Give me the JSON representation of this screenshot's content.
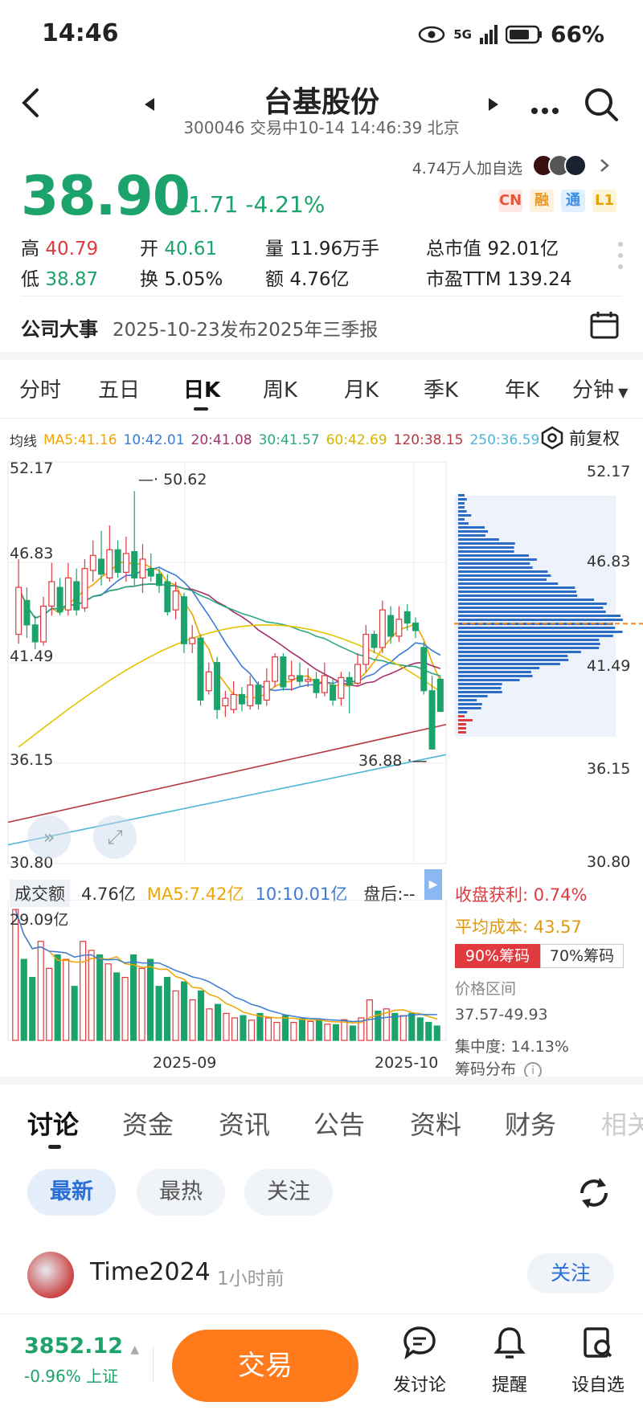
{
  "status": {
    "time": "14:46",
    "battery": "66%",
    "network": "5G"
  },
  "header": {
    "title": "台基股份",
    "subtitle": "300046 交易中10-14 14:46:39 北京"
  },
  "quote": {
    "price": "38.90",
    "change": "-1.71",
    "change_pct": "-4.21%",
    "follow_text": "4.74万人加自选",
    "badges": [
      "CN",
      "融",
      "通",
      "L1"
    ],
    "high_label": "高",
    "high": "40.79",
    "low_label": "低",
    "low": "38.87",
    "open_label": "开",
    "open": "40.61",
    "turnover_label": "换",
    "turnover": "5.05%",
    "volume_label": "量",
    "volume": "11.96万手",
    "amount_label": "额",
    "amount": "4.76亿",
    "mktcap_label": "总市值",
    "mktcap": "92.01亿",
    "pe_label": "市盈TTM",
    "pe": "139.24"
  },
  "event": {
    "label": "公司大事",
    "text": "2025-10-23发布2025年三季报"
  },
  "chart_tabs": [
    "分时",
    "五日",
    "日K",
    "周K",
    "月K",
    "季K",
    "年K",
    "分钟"
  ],
  "active_tab": "日K",
  "ma": {
    "label": "均线",
    "items": [
      "MA5:41.16",
      "10:42.01",
      "20:41.08",
      "30:41.57",
      "60:42.69",
      "120:38.15",
      "250:36.59"
    ],
    "colors": [
      "#f0a500",
      "#3a7bd5",
      "#a2306e",
      "#2aa87e",
      "#e6c200",
      "#b5383e",
      "#4cb6d8"
    ],
    "adjust": "前复权"
  },
  "price_axis": [
    "52.17",
    "46.83",
    "41.49",
    "36.15",
    "30.80"
  ],
  "price_marks": {
    "high": "50.62",
    "low": "36.88"
  },
  "volume": {
    "label": "成交额",
    "value": "4.76亿",
    "ma5": "MA5:7.42亿",
    "ma10": "10:10.01亿",
    "after": "盘后:--",
    "max": "29.09亿",
    "dates": [
      "2025-09",
      "2025-10"
    ]
  },
  "chips": {
    "profit_label": "收盘获利:",
    "profit": "0.74%",
    "cost_label": "平均成本:",
    "cost": "43.57",
    "tab90": "90%筹码",
    "tab70": "70%筹码",
    "range_label": "价格区间",
    "range": "37.57-49.93",
    "concentration": "集中度: 14.13%",
    "dist_label": "筹码分布"
  },
  "bottom_tabs": [
    "讨论",
    "资金",
    "资讯",
    "公告",
    "资料",
    "财务",
    "相关"
  ],
  "filter_pills": [
    "最新",
    "最热",
    "关注"
  ],
  "post": {
    "user": "Time2024",
    "time": "1小时前",
    "follow": "关注"
  },
  "footer": {
    "index_value": "3852.12",
    "index_change": "-0.96%",
    "index_name": "上证",
    "trade": "交易",
    "nav": [
      "发讨论",
      "提醒",
      "设自选"
    ]
  },
  "chart_data": {
    "type": "candlestick",
    "ylim": [
      30.8,
      52.17
    ],
    "candles": [
      {
        "o": 43.0,
        "c": 45.5,
        "h": 47.0,
        "l": 42.5
      },
      {
        "o": 44.8,
        "c": 43.5,
        "h": 45.5,
        "l": 42.8
      },
      {
        "o": 43.5,
        "c": 42.6,
        "h": 44.0,
        "l": 42.2
      },
      {
        "o": 42.6,
        "c": 44.5,
        "h": 45.0,
        "l": 42.4
      },
      {
        "o": 44.5,
        "c": 45.8,
        "h": 46.8,
        "l": 44.0
      },
      {
        "o": 45.5,
        "c": 44.2,
        "h": 46.0,
        "l": 44.0
      },
      {
        "o": 44.3,
        "c": 46.0,
        "h": 46.8,
        "l": 44.0
      },
      {
        "o": 45.8,
        "c": 44.3,
        "h": 46.5,
        "l": 44.0
      },
      {
        "o": 44.4,
        "c": 46.5,
        "h": 47.0,
        "l": 44.2
      },
      {
        "o": 46.4,
        "c": 47.2,
        "h": 48.0,
        "l": 45.8
      },
      {
        "o": 47.0,
        "c": 46.2,
        "h": 48.5,
        "l": 45.6
      },
      {
        "o": 46.0,
        "c": 47.5,
        "h": 48.8,
        "l": 45.8
      },
      {
        "o": 47.5,
        "c": 46.3,
        "h": 48.0,
        "l": 46.0
      },
      {
        "o": 46.3,
        "c": 47.3,
        "h": 48.2,
        "l": 45.8
      },
      {
        "o": 47.4,
        "c": 46.0,
        "h": 50.62,
        "l": 45.6
      },
      {
        "o": 46.0,
        "c": 47.0,
        "h": 47.8,
        "l": 45.2
      },
      {
        "o": 46.5,
        "c": 46.1,
        "h": 47.3,
        "l": 45.8
      },
      {
        "o": 46.2,
        "c": 45.6,
        "h": 46.5,
        "l": 45.2
      },
      {
        "o": 45.8,
        "c": 44.2,
        "h": 46.2,
        "l": 44.0
      },
      {
        "o": 44.3,
        "c": 45.3,
        "h": 45.8,
        "l": 43.8
      },
      {
        "o": 45.0,
        "c": 42.5,
        "h": 45.2,
        "l": 42.0
      },
      {
        "o": 42.5,
        "c": 42.8,
        "h": 43.5,
        "l": 42.0
      },
      {
        "o": 42.8,
        "c": 39.5,
        "h": 43.0,
        "l": 39.2
      },
      {
        "o": 40.0,
        "c": 41.0,
        "h": 41.5,
        "l": 39.8
      },
      {
        "o": 41.5,
        "c": 39.0,
        "h": 41.8,
        "l": 38.5
      },
      {
        "o": 39.2,
        "c": 39.6,
        "h": 40.0,
        "l": 38.6
      },
      {
        "o": 39.0,
        "c": 39.8,
        "h": 40.5,
        "l": 38.8
      },
      {
        "o": 39.8,
        "c": 39.3,
        "h": 40.2,
        "l": 38.9
      },
      {
        "o": 39.2,
        "c": 40.3,
        "h": 40.8,
        "l": 39.0
      },
      {
        "o": 40.3,
        "c": 39.3,
        "h": 40.5,
        "l": 39.0
      },
      {
        "o": 39.5,
        "c": 40.5,
        "h": 41.2,
        "l": 39.2
      },
      {
        "o": 40.5,
        "c": 41.8,
        "h": 42.0,
        "l": 40.2
      },
      {
        "o": 41.8,
        "c": 40.2,
        "h": 42.0,
        "l": 40.0
      },
      {
        "o": 40.6,
        "c": 40.8,
        "h": 41.6,
        "l": 40.0
      },
      {
        "o": 40.8,
        "c": 40.5,
        "h": 41.5,
        "l": 40.2
      },
      {
        "o": 40.5,
        "c": 40.6,
        "h": 41.2,
        "l": 40.2
      },
      {
        "o": 40.6,
        "c": 39.9,
        "h": 41.0,
        "l": 39.6
      },
      {
        "o": 39.9,
        "c": 40.8,
        "h": 41.5,
        "l": 39.7
      },
      {
        "o": 40.3,
        "c": 39.5,
        "h": 40.6,
        "l": 39.2
      },
      {
        "o": 39.6,
        "c": 40.7,
        "h": 41.0,
        "l": 39.2
      },
      {
        "o": 40.7,
        "c": 40.3,
        "h": 41.0,
        "l": 38.8
      },
      {
        "o": 40.4,
        "c": 41.4,
        "h": 42.0,
        "l": 40.2
      },
      {
        "o": 41.4,
        "c": 43.0,
        "h": 43.5,
        "l": 41.0
      },
      {
        "o": 43.0,
        "c": 42.3,
        "h": 43.2,
        "l": 42.0
      },
      {
        "o": 42.3,
        "c": 44.3,
        "h": 44.8,
        "l": 42.0
      },
      {
        "o": 44.0,
        "c": 42.9,
        "h": 44.5,
        "l": 42.5
      },
      {
        "o": 42.9,
        "c": 43.8,
        "h": 44.5,
        "l": 42.6
      },
      {
        "o": 44.2,
        "c": 43.6,
        "h": 44.6,
        "l": 43.2
      },
      {
        "o": 43.6,
        "c": 43.2,
        "h": 43.9,
        "l": 42.8
      },
      {
        "o": 42.3,
        "c": 40.0,
        "h": 42.6,
        "l": 39.8
      },
      {
        "o": 40.0,
        "c": 36.9,
        "h": 40.79,
        "l": 36.88
      },
      {
        "o": 40.61,
        "c": 38.9,
        "h": 40.79,
        "l": 38.87
      }
    ],
    "volumes": [
      29.09,
      18,
      14,
      22,
      16,
      19,
      18,
      12,
      22,
      20,
      19,
      17,
      15,
      14,
      19,
      16,
      18,
      12,
      14,
      11,
      13,
      9,
      11,
      7,
      8,
      6,
      5,
      5.5,
      4.5,
      6,
      5,
      4,
      5.5,
      4,
      4.8,
      4.2,
      4.5,
      3.6,
      3.5,
      4.6,
      3.2,
      5,
      9,
      6.5,
      7,
      6,
      5.5,
      6,
      5,
      4,
      3.2
    ]
  }
}
